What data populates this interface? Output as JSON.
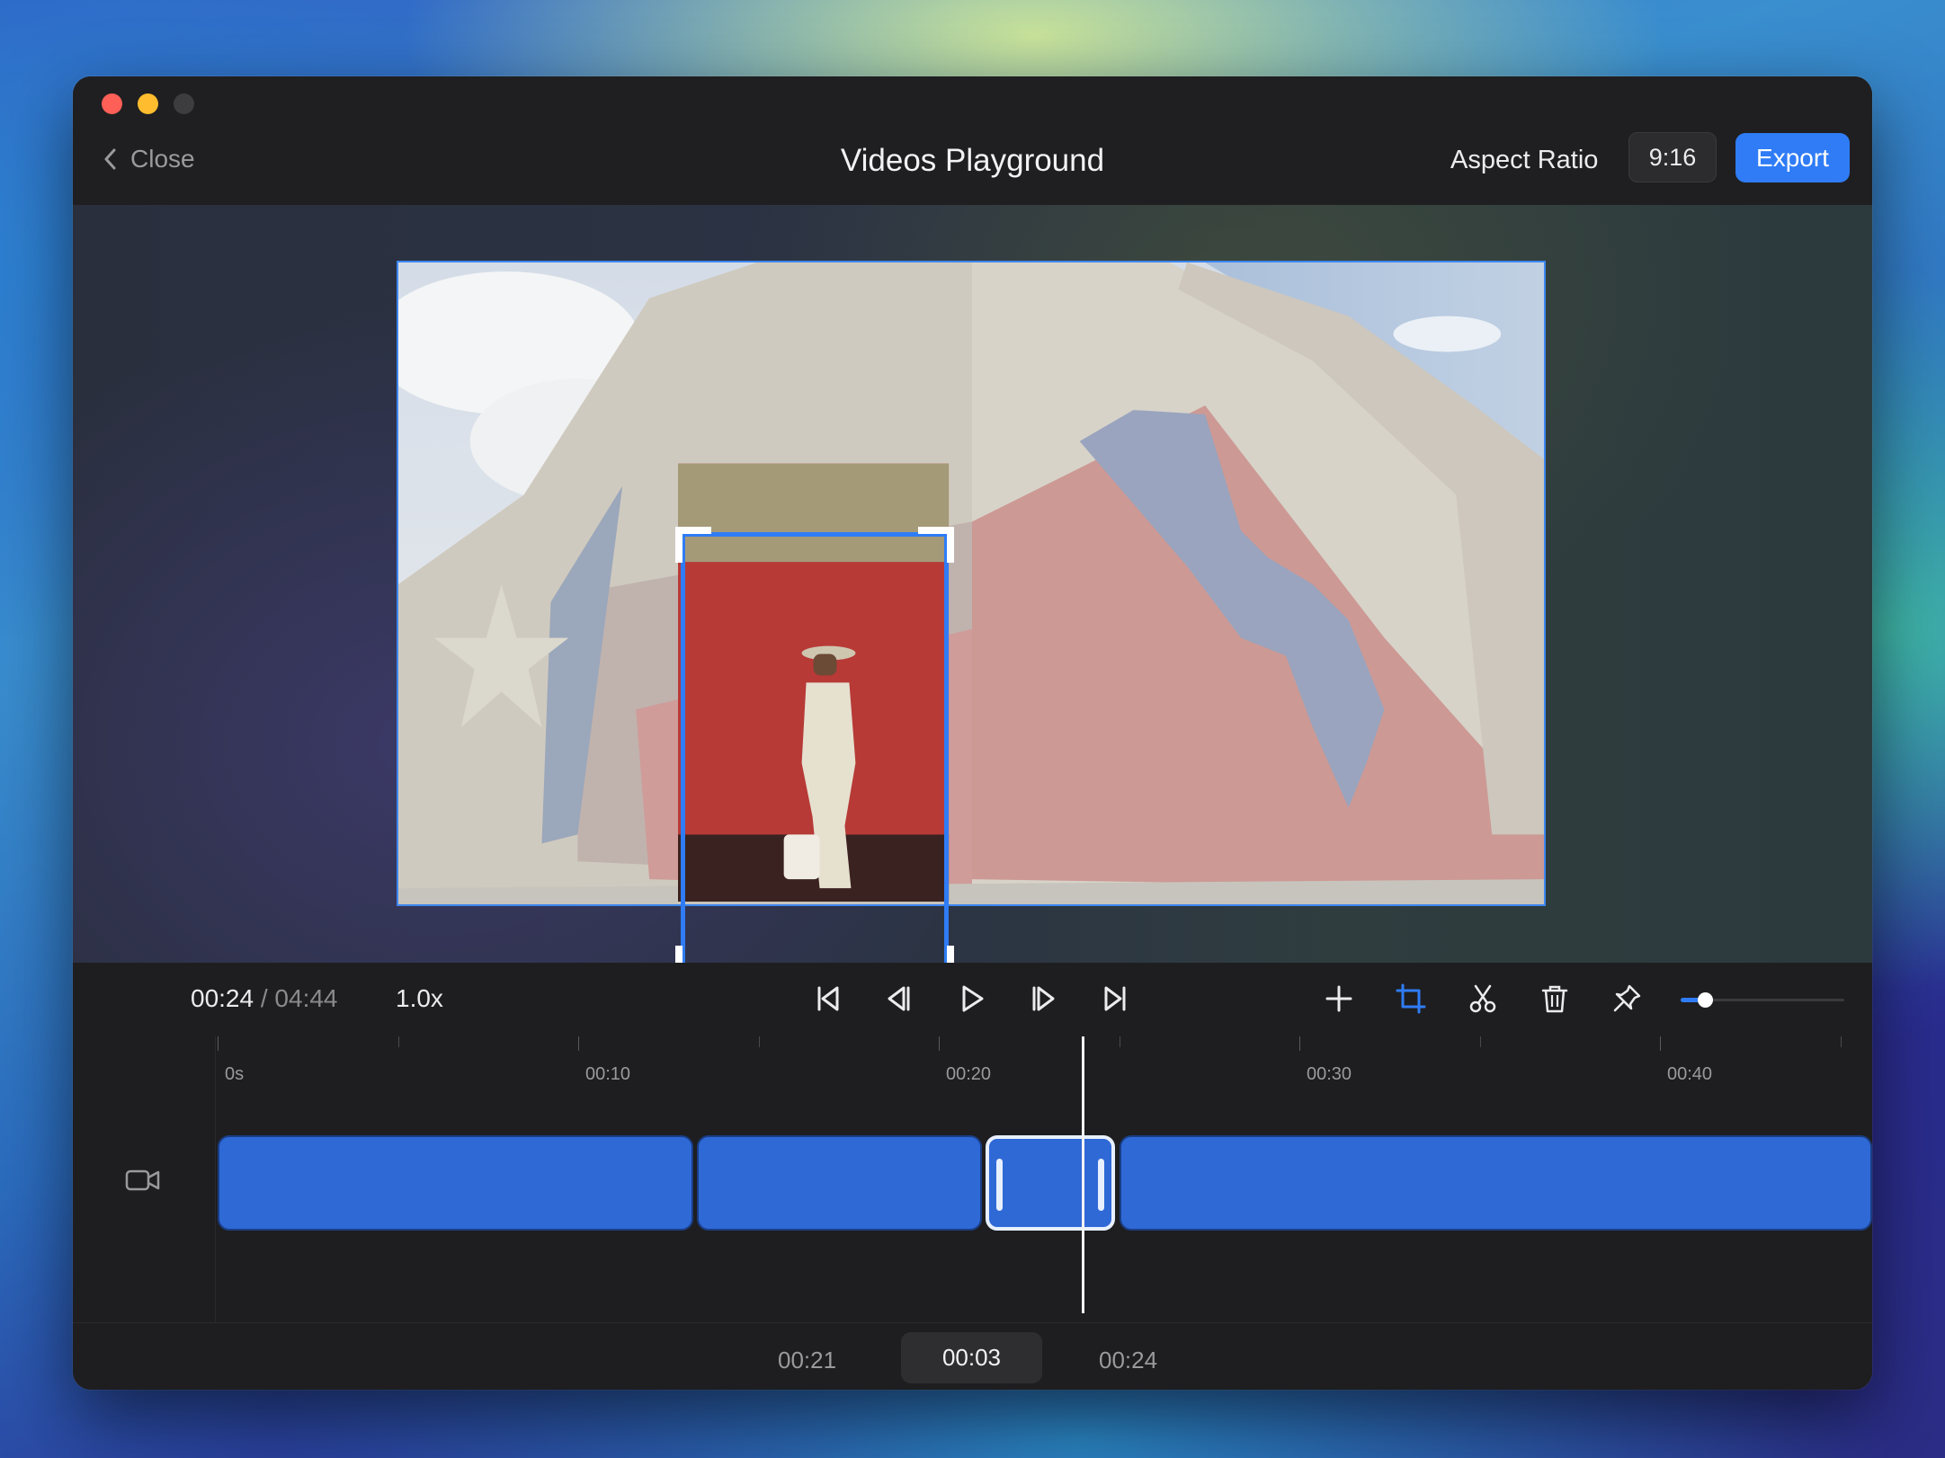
{
  "window": {
    "title": "Videos Playground",
    "close_label": "Close",
    "aspect_ratio_label": "Aspect Ratio",
    "aspect_ratio_value": "9:16",
    "export_label": "Export"
  },
  "playback": {
    "current_time": "00:24",
    "separator": " / ",
    "total_time": "04:44",
    "speed": "1.0x",
    "zoom_level": 0.15
  },
  "toolbar": {
    "transport": [
      "skip-to-start-icon",
      "step-back-icon",
      "play-icon",
      "step-forward-icon",
      "skip-to-end-icon"
    ],
    "edit": [
      "add-icon",
      "crop-icon",
      "scissors-icon",
      "trash-icon",
      "pin-icon"
    ],
    "active_edit_tool": "crop-icon"
  },
  "timeline": {
    "ticks": [
      "0s",
      "00:10",
      "00:20",
      "00:30",
      "00:40"
    ],
    "track_icon": "video-camera-icon",
    "clips": [
      {
        "start": 0,
        "end": 13.2,
        "selected": false
      },
      {
        "start": 13.3,
        "end": 21.2,
        "selected": false
      },
      {
        "start": 21.3,
        "end": 24.9,
        "selected": true
      },
      {
        "start": 25.0,
        "end": 46.0,
        "selected": false
      }
    ],
    "playhead_seconds": 24
  },
  "selection": {
    "start": "00:21",
    "duration": "00:03",
    "end": "00:24"
  },
  "colors": {
    "accent": "#2f7cf6",
    "clip": "#2f69d6",
    "window_bg": "#1e1e20"
  }
}
